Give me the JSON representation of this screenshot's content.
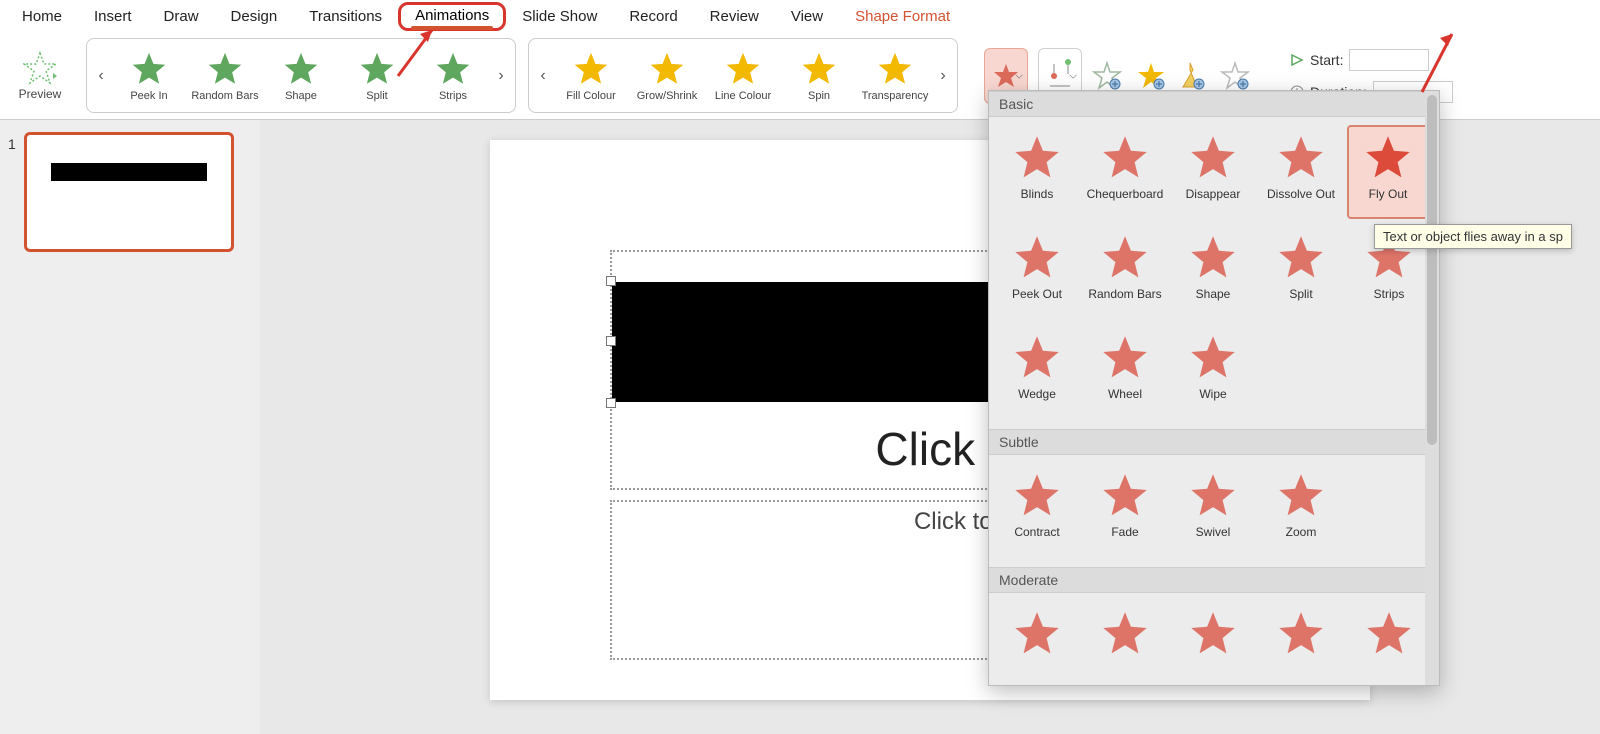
{
  "tabs": [
    "Home",
    "Insert",
    "Draw",
    "Design",
    "Transitions",
    "Animations",
    "Slide Show",
    "Record",
    "Review",
    "View",
    "Shape Format"
  ],
  "active_tab": "Animations",
  "format_tab": "Shape Format",
  "preview_label": "Preview",
  "gallery1": [
    {
      "label": "Peek In",
      "color": "#5fa65f"
    },
    {
      "label": "Random Bars",
      "color": "#5fa65f"
    },
    {
      "label": "Shape",
      "color": "#5fa65f"
    },
    {
      "label": "Split",
      "color": "#5fa65f"
    },
    {
      "label": "Strips",
      "color": "#5fa65f"
    }
  ],
  "gallery2": [
    {
      "label": "Fill Colour",
      "color": "#f2b900"
    },
    {
      "label": "Grow/Shrink",
      "color": "#f2b900"
    },
    {
      "label": "Line Colour",
      "color": "#f2b900"
    },
    {
      "label": "Spin",
      "color": "#f2b900"
    },
    {
      "label": "Transparency",
      "color": "#f2b900"
    }
  ],
  "timing": {
    "start_label": "Start:",
    "duration_label": "Duration:"
  },
  "thumb_num": "1",
  "title_text": "Click to a",
  "sub_text": "Click to ad",
  "dd": {
    "sections": [
      {
        "name": "Basic",
        "items": [
          {
            "label": "Blinds"
          },
          {
            "label": "Chequerboard"
          },
          {
            "label": "Disappear"
          },
          {
            "label": "Dissolve Out"
          },
          {
            "label": "Fly Out",
            "selected": true
          },
          {
            "label": "Peek Out"
          },
          {
            "label": "Random Bars"
          },
          {
            "label": "Shape"
          },
          {
            "label": "Split"
          },
          {
            "label": "Strips"
          },
          {
            "label": "Wedge"
          },
          {
            "label": "Wheel"
          },
          {
            "label": "Wipe"
          }
        ]
      },
      {
        "name": "Subtle",
        "items": [
          {
            "label": "Contract"
          },
          {
            "label": "Fade"
          },
          {
            "label": "Swivel"
          },
          {
            "label": "Zoom"
          }
        ]
      },
      {
        "name": "Moderate",
        "items": [
          {
            "label": ""
          },
          {
            "label": ""
          },
          {
            "label": ""
          },
          {
            "label": ""
          },
          {
            "label": ""
          }
        ]
      }
    ]
  },
  "tooltip_text": "Text or object flies away in a sp"
}
